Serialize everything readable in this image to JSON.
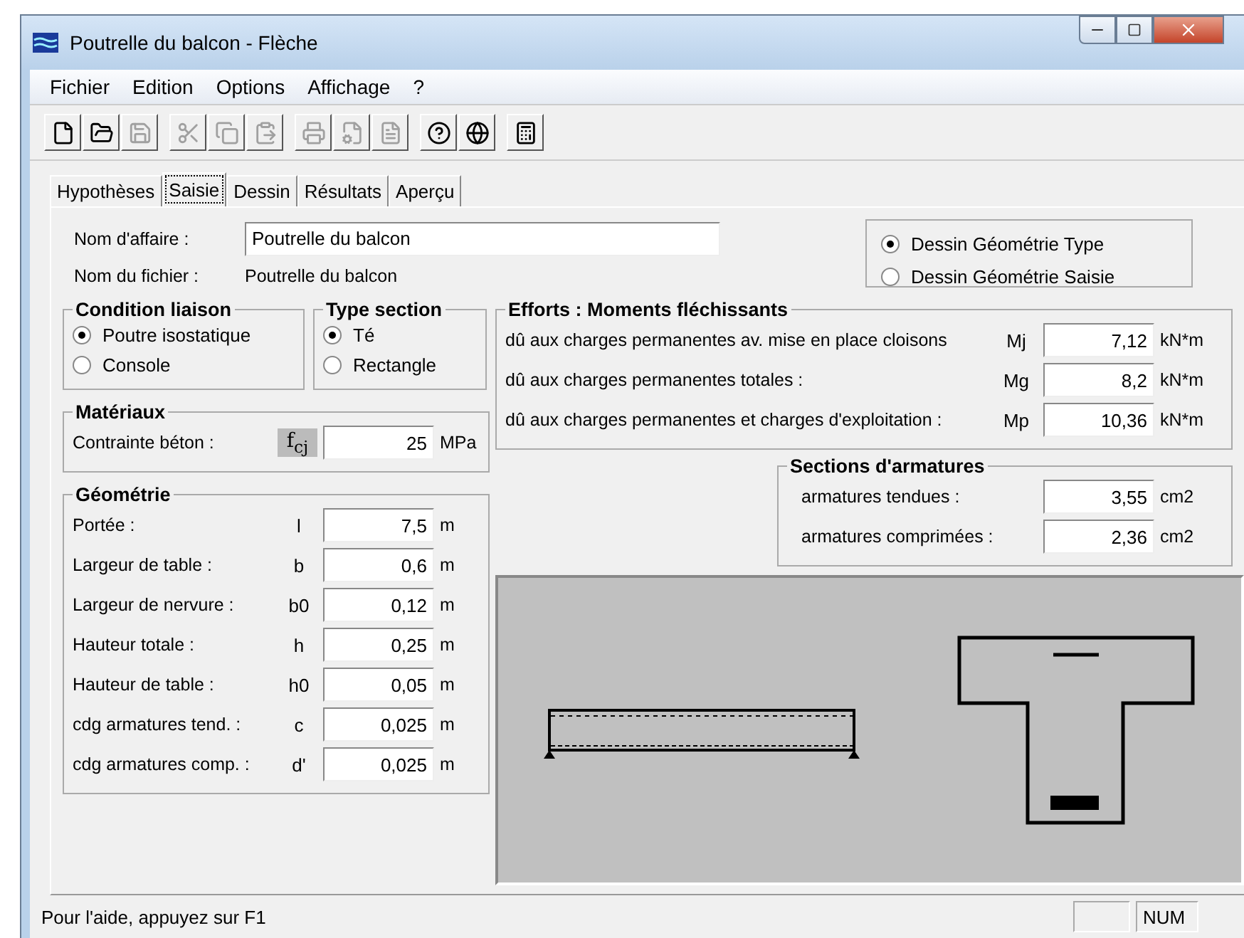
{
  "window": {
    "title": "Poutrelle du balcon - Flèche"
  },
  "menu": [
    "Fichier",
    "Edition",
    "Options",
    "Affichage",
    "?"
  ],
  "toolbar": [
    [
      {
        "disabled": false
      },
      {
        "disabled": false
      },
      {
        "disabled": true
      }
    ],
    [
      {
        "disabled": true
      },
      {
        "disabled": true
      },
      {
        "disabled": true
      }
    ],
    [
      {
        "disabled": true
      },
      {
        "disabled": true
      },
      {
        "disabled": true
      }
    ],
    [
      {
        "disabled": false
      },
      {
        "disabled": false
      }
    ],
    [
      {
        "disabled": false
      }
    ]
  ],
  "tabs": [
    {
      "label": "Hypothèses",
      "selected": false
    },
    {
      "label": "Saisie",
      "selected": true
    },
    {
      "label": "Dessin",
      "selected": false
    },
    {
      "label": "Résultats",
      "selected": false
    },
    {
      "label": "Aperçu",
      "selected": false
    }
  ],
  "affaire": {
    "label": "Nom d'affaire :",
    "value": "Poutrelle du balcon"
  },
  "fichier": {
    "label": "Nom du fichier :",
    "value": "Poutrelle du balcon"
  },
  "dessin_mode": [
    {
      "label": "Dessin Géométrie Type",
      "selected": true
    },
    {
      "label": "Dessin Géométrie Saisie",
      "selected": false
    }
  ],
  "condition": {
    "title": "Condition liaison",
    "options": [
      {
        "label": "Poutre isostatique",
        "selected": true
      },
      {
        "label": "Console",
        "selected": false
      }
    ]
  },
  "type_section": {
    "title": "Type section",
    "options": [
      {
        "label": "Té",
        "selected": true
      },
      {
        "label": "Rectangle",
        "selected": false
      }
    ]
  },
  "materiaux": {
    "title": "Matériaux",
    "label": "Contrainte béton :",
    "symbol": "f$_{cj}$",
    "value": "25",
    "unit": "MPa"
  },
  "geometrie": {
    "title": "Géométrie",
    "rows": [
      {
        "label": "Portée :",
        "symbol": "l",
        "value": "7,5",
        "unit": "m"
      },
      {
        "label": "Largeur de table :",
        "symbol": "b",
        "value": "0,6",
        "unit": "m"
      },
      {
        "label": "Largeur de nervure :",
        "symbol": "b0",
        "value": "0,12",
        "unit": "m"
      },
      {
        "label": "Hauteur totale :",
        "symbol": "h",
        "value": "0,25",
        "unit": "m"
      },
      {
        "label": "Hauteur de table :",
        "symbol": "h0",
        "value": "0,05",
        "unit": "m"
      },
      {
        "label": "cdg armatures tend. :",
        "symbol": "c",
        "value": "0,025",
        "unit": "m"
      },
      {
        "label": "cdg armatures comp. :",
        "symbol": "d'",
        "value": "0,025",
        "unit": "m"
      }
    ]
  },
  "efforts": {
    "title": "Efforts : Moments fléchissants",
    "rows": [
      {
        "label": "dû aux charges permanentes av. mise en place cloisons",
        "symbol": "Mj",
        "value": "7,12",
        "unit": "kN*m"
      },
      {
        "label": "dû aux charges permanentes totales :",
        "symbol": "Mg",
        "value": "8,2",
        "unit": "kN*m"
      },
      {
        "label": "dû aux charges permanentes et charges d'exploitation :",
        "symbol": "Mp",
        "value": "10,36",
        "unit": "kN*m"
      }
    ]
  },
  "sections": {
    "title": "Sections d'armatures",
    "rows": [
      {
        "label": "armatures tendues :",
        "value": "3,55",
        "unit": "cm2"
      },
      {
        "label": "armatures comprimées :",
        "value": "2,36",
        "unit": "cm2"
      }
    ]
  },
  "status_bar": {
    "text": "Pour l'aide, appuyez sur F1",
    "panes": [
      "NUM"
    ]
  }
}
